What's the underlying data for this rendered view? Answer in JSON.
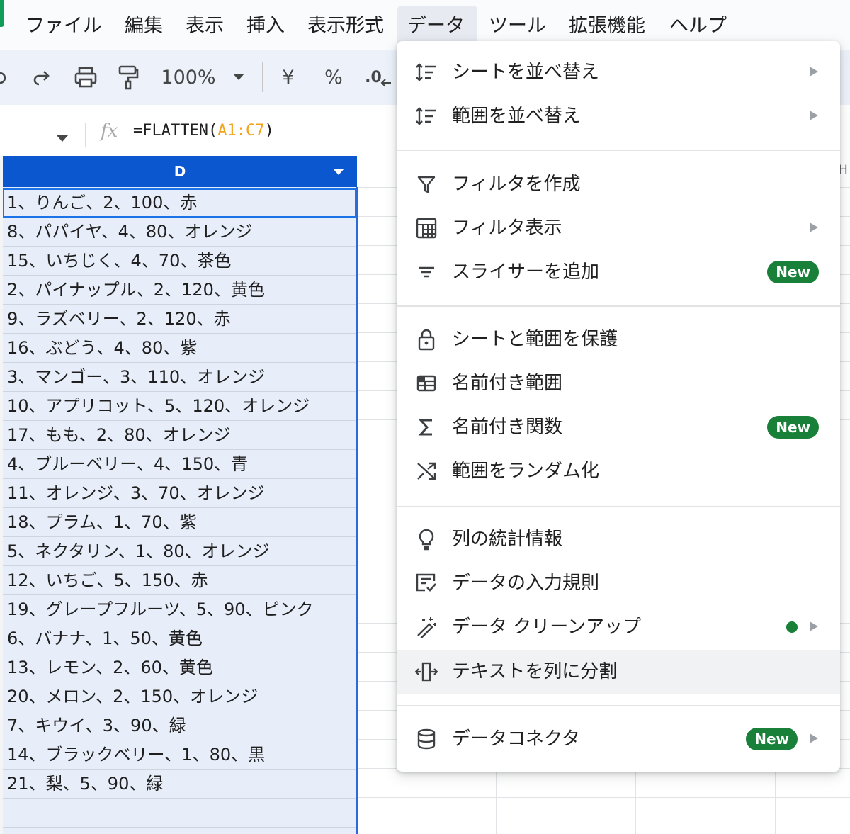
{
  "menubar": {
    "items": [
      "ファイル",
      "編集",
      "表示",
      "挿入",
      "表示形式",
      "データ",
      "ツール",
      "拡張機能",
      "ヘルプ"
    ],
    "active_item": "データ"
  },
  "toolbar": {
    "zoom": "100%",
    "currency": "¥",
    "percent": "%",
    "decimal": ".0"
  },
  "formula_bar": {
    "fx_label": "fx",
    "formula_prefix": "=FLATTEN(",
    "formula_range": "A1:C7",
    "formula_suffix": ")"
  },
  "grid": {
    "column_header": "D",
    "next_column_peek": "H",
    "rows": [
      "1、りんご、2、100、赤",
      "8、パパイヤ、4、80、オレンジ",
      "15、いちじく、4、70、茶色",
      "2、パイナップル、2、120、黄色",
      "9、ラズベリー、2、120、赤",
      "16、ぶどう、4、80、紫",
      "3、マンゴー、3、110、オレンジ",
      "10、アプリコット、5、120、オレンジ",
      "17、もも、2、80、オレンジ",
      "4、ブルーベリー、4、150、青",
      "11、オレンジ、3、70、オレンジ",
      "18、プラム、1、70、紫",
      "5、ネクタリン、1、80、オレンジ",
      "12、いちご、5、150、赤",
      "19、グレープフルーツ、5、90、ピンク",
      "6、バナナ、1、50、黄色",
      "13、レモン、2、60、黄色",
      "20、メロン、2、150、オレンジ",
      "7、キウイ、3、90、緑",
      "14、ブラックベリー、1、80、黒",
      "21、梨、5、90、緑"
    ]
  },
  "data_menu": {
    "items": [
      {
        "label": "シートを並べ替え",
        "icon": "sort-icon",
        "submenu": true
      },
      {
        "label": "範囲を並べ替え",
        "icon": "sort-icon",
        "submenu": true
      },
      {
        "label": "フィルタを作成",
        "icon": "filter-icon"
      },
      {
        "label": "フィルタ表示",
        "icon": "filter-view-icon",
        "submenu": true
      },
      {
        "label": "スライサーを追加",
        "icon": "slicer-icon",
        "badge": "New"
      },
      {
        "label": "シートと範囲を保護",
        "icon": "lock-icon"
      },
      {
        "label": "名前付き範囲",
        "icon": "named-range-icon"
      },
      {
        "label": "名前付き関数",
        "icon": "sigma-icon",
        "badge": "New"
      },
      {
        "label": "範囲をランダム化",
        "icon": "shuffle-icon"
      },
      {
        "label": "列の統計情報",
        "icon": "lightbulb-icon"
      },
      {
        "label": "データの入力規則",
        "icon": "validation-icon"
      },
      {
        "label": "データ クリーンアップ",
        "icon": "magic-wand-icon",
        "submenu": true,
        "dot": true
      },
      {
        "label": "テキストを列に分割",
        "icon": "split-icon",
        "hovered": true
      },
      {
        "label": "データコネクタ",
        "icon": "database-icon",
        "submenu": true,
        "badge": "New"
      }
    ]
  },
  "colors": {
    "selected_header": "#0b57d0",
    "selected_column": "#e8eef9",
    "badge_green": "#188038",
    "formula_range": "#f4a21a"
  }
}
